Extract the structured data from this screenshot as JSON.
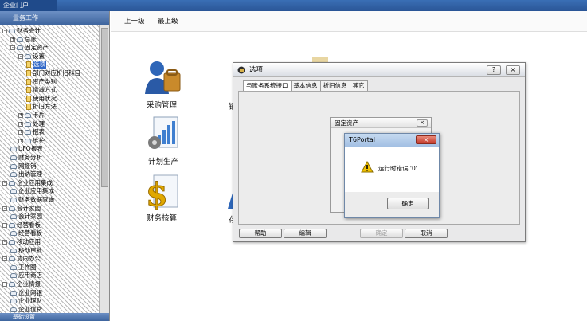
{
  "window": {
    "title": "企业门户"
  },
  "tree": {
    "header": "业务工作",
    "footer": "基础设置",
    "items": [
      {
        "label": "财务会计",
        "level": 0,
        "expander": "-",
        "kind": "folder"
      },
      {
        "label": "总账",
        "level": 1,
        "expander": "+",
        "kind": "folder"
      },
      {
        "label": "固定资产",
        "level": 1,
        "expander": "-",
        "kind": "folder"
      },
      {
        "label": "设置",
        "level": 2,
        "expander": "-",
        "kind": "folder"
      },
      {
        "label": "选项",
        "level": 3,
        "expander": "",
        "kind": "leaf",
        "selected": true
      },
      {
        "label": "部门对应折旧科目",
        "level": 3,
        "expander": "",
        "kind": "leaf"
      },
      {
        "label": "资产类别",
        "level": 3,
        "expander": "",
        "kind": "leaf"
      },
      {
        "label": "增减方式",
        "level": 3,
        "expander": "",
        "kind": "leaf"
      },
      {
        "label": "使用状况",
        "level": 3,
        "expander": "",
        "kind": "leaf"
      },
      {
        "label": "折旧方法",
        "level": 3,
        "expander": "",
        "kind": "leaf"
      },
      {
        "label": "卡片",
        "level": 2,
        "expander": "+",
        "kind": "folder"
      },
      {
        "label": "处理",
        "level": 2,
        "expander": "+",
        "kind": "folder"
      },
      {
        "label": "报表",
        "level": 2,
        "expander": "+",
        "kind": "folder"
      },
      {
        "label": "维护",
        "level": 2,
        "expander": "+",
        "kind": "folder"
      },
      {
        "label": "UFO报表",
        "level": 1,
        "expander": "",
        "kind": "folder"
      },
      {
        "label": "财务分析",
        "level": 1,
        "expander": "",
        "kind": "folder"
      },
      {
        "label": "网报销",
        "level": 1,
        "expander": "",
        "kind": "folder"
      },
      {
        "label": "出纳管理",
        "level": 1,
        "expander": "",
        "kind": "folder"
      },
      {
        "label": "企业应用集成",
        "level": 0,
        "expander": "-",
        "kind": "folder"
      },
      {
        "label": "企业应用集成",
        "level": 1,
        "expander": "",
        "kind": "folder"
      },
      {
        "label": "财务数据查询",
        "level": 1,
        "expander": "",
        "kind": "folder"
      },
      {
        "label": "会计家园",
        "level": 0,
        "expander": "-",
        "kind": "folder"
      },
      {
        "label": "会计家园",
        "level": 1,
        "expander": "",
        "kind": "folder"
      },
      {
        "label": "经营看板",
        "level": 0,
        "expander": "-",
        "kind": "folder"
      },
      {
        "label": "经营看板",
        "level": 1,
        "expander": "",
        "kind": "folder"
      },
      {
        "label": "移动应用",
        "level": 0,
        "expander": "-",
        "kind": "folder"
      },
      {
        "label": "移动审批",
        "level": 1,
        "expander": "",
        "kind": "folder"
      },
      {
        "label": "协同办公",
        "level": 0,
        "expander": "-",
        "kind": "folder"
      },
      {
        "label": "工作圈",
        "level": 1,
        "expander": "",
        "kind": "folder"
      },
      {
        "label": "应用商店",
        "level": 1,
        "expander": "",
        "kind": "folder"
      },
      {
        "label": "企业情报",
        "level": 0,
        "expander": "-",
        "kind": "folder"
      },
      {
        "label": "企业网银",
        "level": 1,
        "expander": "",
        "kind": "folder"
      },
      {
        "label": "企业理财",
        "level": 1,
        "expander": "",
        "kind": "folder"
      },
      {
        "label": "企业信贷",
        "level": 1,
        "expander": "",
        "kind": "folder"
      }
    ]
  },
  "toolbar": {
    "up": "上一级",
    "top": "最上级"
  },
  "desktop": {
    "purchase": "采购管理",
    "plan": "计划生产",
    "finance": "财务核算",
    "partial_1": "销",
    "partial_2": "存"
  },
  "options_dialog": {
    "title": "选项",
    "help_ctrl": "?",
    "close_ctrl": "×",
    "tabs": [
      "与账务系统接口",
      "基本信息",
      "折旧信息",
      "其它"
    ],
    "active_tab": 0,
    "buttons": {
      "help": "帮助",
      "edit": "编辑",
      "ok": "确定",
      "cancel": "取消"
    }
  },
  "fixed_assets_window": {
    "title": "固定资产",
    "close": "×"
  },
  "alert": {
    "title": "T6Portal",
    "close": "×",
    "message": "运行时错误 '0'",
    "ok": "确定"
  },
  "colors": {
    "accent": "#3168c8",
    "title_bar": "#2a5596",
    "warning": "#f2c200"
  }
}
